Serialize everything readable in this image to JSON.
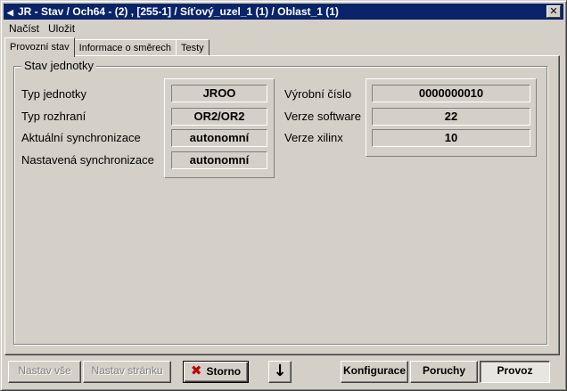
{
  "window": {
    "title": "JR - Stav / Och64 - (2) , [255-1] / Síťový_uzel_1 (1) / Oblast_1 (1)",
    "close_glyph": "✕"
  },
  "menu": {
    "items": [
      {
        "label": "Načíst",
        "accesskey": "N"
      },
      {
        "label": "Uložit",
        "accesskey": "U"
      }
    ]
  },
  "tabs": [
    {
      "label": "Provozní stav",
      "active": true
    },
    {
      "label": "Informace o směrech",
      "active": false
    },
    {
      "label": "Testy",
      "active": false
    }
  ],
  "group": {
    "title": "Stav jednotky",
    "left_fields": [
      {
        "label": "Typ jednotky",
        "value": "JROO"
      },
      {
        "label": "Typ rozhraní",
        "value": "OR2/OR2"
      },
      {
        "label": "Aktuální synchronizace",
        "value": "autonomní"
      },
      {
        "label": "Nastavená synchronizace",
        "value": "autonomní"
      }
    ],
    "right_fields": [
      {
        "label": "Výrobní číslo",
        "value": "0000000010"
      },
      {
        "label": "Verze software",
        "value": "22"
      },
      {
        "label": "Verze xilinx",
        "value": "10"
      }
    ]
  },
  "footer": {
    "set_all_label": "Nastav vše",
    "set_page_label": "Nastav stránku",
    "cancel_label": "Storno",
    "down_glyph": "🡓",
    "config_label": "Konfigurace",
    "faults_label": "Poruchy",
    "operation_label": "Provoz"
  },
  "colors": {
    "titlebar": "#0a246a",
    "face": "#d4d0c8",
    "cancel_icon": "#c00000"
  }
}
